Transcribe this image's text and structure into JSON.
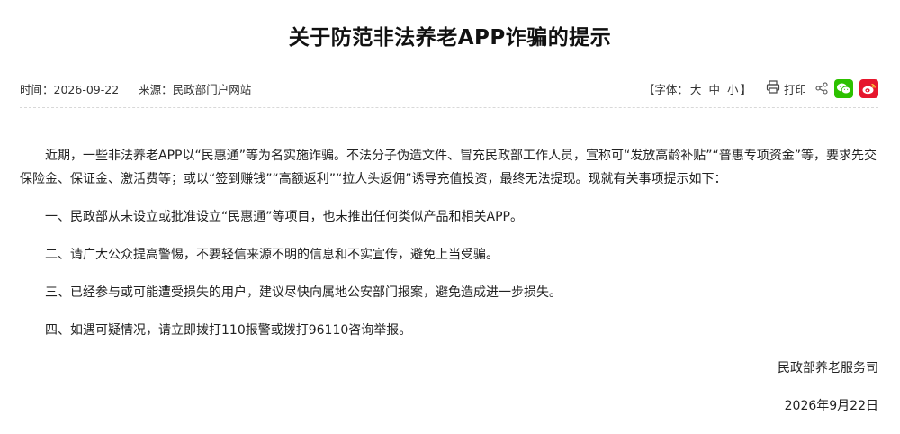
{
  "article": {
    "title": "关于防范非法养老APP诈骗的提示",
    "meta": {
      "time_label": "时间：",
      "time_value": "2026-09-22",
      "source_label": "来源：",
      "source_value": "民政部门户网站"
    },
    "tools": {
      "font_label": "【字体：",
      "font_large": "大",
      "font_medium": "中",
      "font_small": "小",
      "font_close": "】",
      "print_label": "打印",
      "share_icon": "share-icon",
      "wechat_icon": "wechat-icon",
      "weibo_icon": "weibo-icon",
      "wechat_color": "#2dc100",
      "weibo_color": "#e6162d"
    },
    "intro": "近期，一些非法养老APP以“民惠通”等为名实施诈骗。不法分子伪造文件、冒充民政部工作人员，宣称可“发放高龄补贴”“普惠专项资金”等，要求先交保险金、保证金、激活费等；或以“签到赚钱”“高额返利”“拉人头返佣”诱导充值投资，最终无法提现。现就有关事项提示如下：",
    "items": [
      "一、民政部从未设立或批准设立“民惠通”等项目，也未推出任何类似产品和相关APP。",
      "二、请广大公众提高警惕，不要轻信来源不明的信息和不实宣传，避免上当受骗。",
      "三、已经参与或可能遭受损失的用户，建议尽快向属地公安部门报案，避免造成进一步损失。",
      "四、如遇可疑情况，请立即拨打110报警或拨打96110咨询举报。"
    ],
    "signature": "民政部养老服务司",
    "sign_date": "2026年9月22日"
  }
}
